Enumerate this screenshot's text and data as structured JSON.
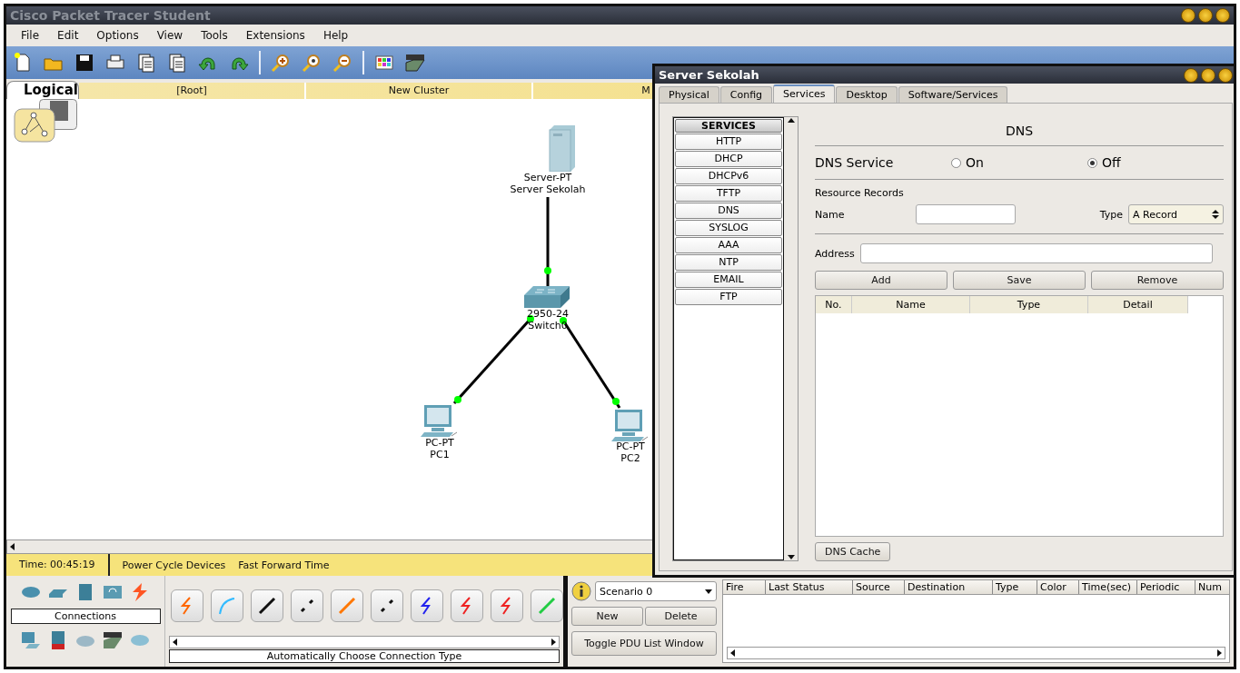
{
  "window": {
    "title": "Cisco Packet Tracer Student"
  },
  "menu": [
    "File",
    "Edit",
    "Options",
    "View",
    "Tools",
    "Extensions",
    "Help"
  ],
  "workspace": {
    "tab": "Logical",
    "path": [
      "[Root]",
      "New Cluster",
      "M"
    ]
  },
  "network": {
    "devices": [
      {
        "kind": "server",
        "model": "Server-PT",
        "name": "Server Sekolah"
      },
      {
        "kind": "switch",
        "model": "2950-24",
        "name": "Switch0"
      },
      {
        "kind": "pc",
        "model": "PC-PT",
        "name": "PC1"
      },
      {
        "kind": "pc",
        "model": "PC-PT",
        "name": "PC2"
      }
    ]
  },
  "status_bar": {
    "time": "Time: 00:45:19",
    "buttons": [
      "Power Cycle Devices",
      "Fast Forward Time"
    ]
  },
  "device_panel": {
    "category": "Connections",
    "connection_type": "Automatically Choose Connection Type"
  },
  "scenario": {
    "value": "Scenario 0",
    "buttons": [
      "New",
      "Delete"
    ],
    "toggle": "Toggle PDU List Window"
  },
  "pdu_table": {
    "columns": [
      "Fire",
      "Last Status",
      "Source",
      "Destination",
      "Type",
      "Color",
      "Time(sec)",
      "Periodic",
      "Num"
    ]
  },
  "dialog": {
    "title": "Server Sekolah",
    "tabs": [
      {
        "label": "Physical",
        "selected": false
      },
      {
        "label": "Config",
        "selected": false
      },
      {
        "label": "Services",
        "selected": true
      },
      {
        "label": "Desktop",
        "selected": false
      },
      {
        "label": "Software/Services",
        "selected": false
      }
    ],
    "services": {
      "heading": "SERVICES",
      "items": [
        "HTTP",
        "DHCP",
        "DHCPv6",
        "TFTP",
        "DNS",
        "SYSLOG",
        "AAA",
        "NTP",
        "EMAIL",
        "FTP"
      ]
    },
    "dns": {
      "title": "DNS",
      "service_label": "DNS Service",
      "options": [
        {
          "label": "On",
          "selected": false
        },
        {
          "label": "Off",
          "selected": true
        }
      ],
      "records_label": "Resource Records",
      "name_label": "Name",
      "type_label": "Type",
      "type_value": "A Record",
      "address_label": "Address",
      "buttons": [
        "Add",
        "Save",
        "Remove"
      ],
      "columns": [
        "No.",
        "Name",
        "Type",
        "Detail"
      ],
      "cache_button": "DNS Cache"
    }
  }
}
